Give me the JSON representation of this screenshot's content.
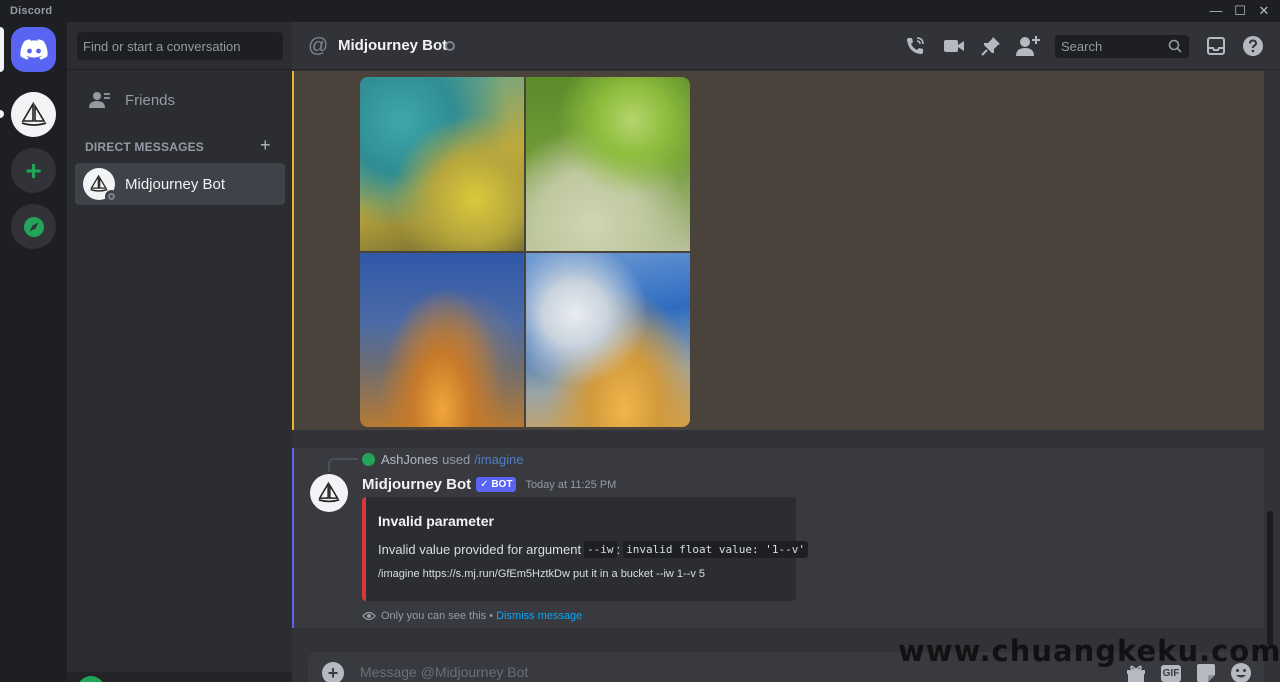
{
  "window": {
    "app_title": "Discord",
    "controls": {
      "minimize": "—",
      "maximize": "☐",
      "close": "✕"
    }
  },
  "rail": {
    "servers": [
      {
        "name": "home",
        "icon": "discord-logo-icon"
      },
      {
        "name": "midjourney",
        "icon": "sailboat-icon"
      },
      {
        "name": "add-server",
        "icon": "plus-icon",
        "glyph": "+"
      },
      {
        "name": "explore",
        "icon": "compass-icon"
      }
    ]
  },
  "sidebar": {
    "search_placeholder": "Find or start a conversation",
    "friends_label": "Friends",
    "dm_header": "DIRECT MESSAGES",
    "dm_add": "+",
    "direct_messages": [
      {
        "name": "Midjourney Bot",
        "status": "offline"
      }
    ]
  },
  "topbar": {
    "at_glyph": "@",
    "title": "Midjourney Bot",
    "search_placeholder": "Search",
    "icons": [
      "phone-call-icon",
      "video-icon",
      "pin-icon",
      "add-member-icon",
      "inbox-icon",
      "help-icon"
    ]
  },
  "messages": {
    "image_grid": {
      "tiles": 4
    },
    "bot_message": {
      "reply_user": "AshJones",
      "reply_used": "used",
      "reply_command": "/imagine",
      "author": "Midjourney Bot",
      "bot_tag": "✓ BOT",
      "timestamp": "Today at 11:25 PM",
      "embed": {
        "title": "Invalid parameter",
        "desc_prefix": "Invalid value provided for argument",
        "code_arg": "--iw",
        "code_error": "invalid float value: '1--v'",
        "command": "/imagine https://s.mj.run/GfEm5HztkDw put it in a bucket --iw 1--v 5",
        "color": "#da373c"
      },
      "ephemeral_text": "Only you can see this •",
      "dismiss_text": "Dismiss message"
    }
  },
  "composer": {
    "plus_glyph": "+",
    "placeholder": "Message @Midjourney Bot",
    "icons": [
      "gift-icon",
      "gif-icon",
      "sticker-icon",
      "emoji-icon"
    ],
    "gif_label": "GIF"
  },
  "watermark": "www.chuangkeku.com",
  "colors": {
    "brand": "#5865f2",
    "highlight_mention": "#f0b232",
    "online": "#23a559"
  }
}
